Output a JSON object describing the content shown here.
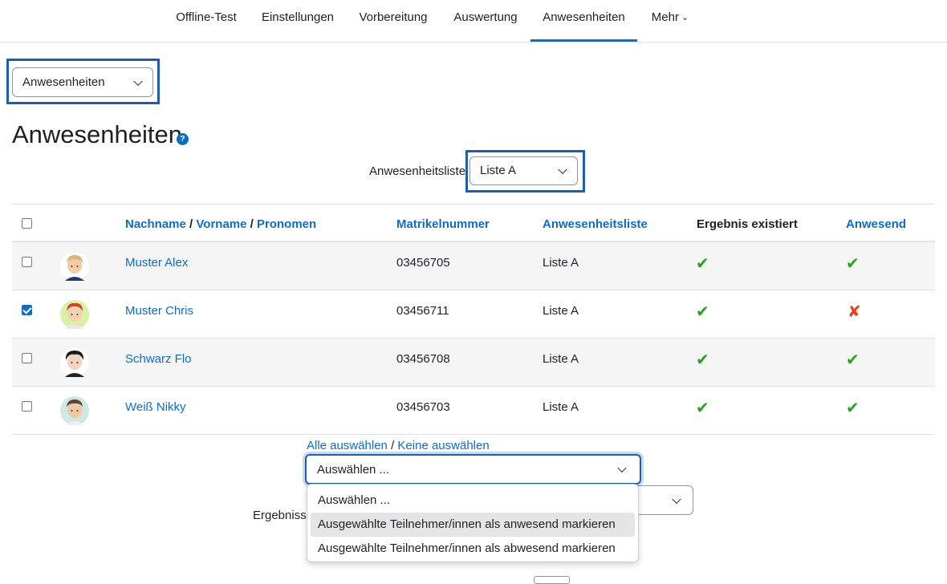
{
  "nav": {
    "items": [
      {
        "label": "Offline-Test"
      },
      {
        "label": "Einstellungen"
      },
      {
        "label": "Vorbereitung"
      },
      {
        "label": "Auswertung"
      },
      {
        "label": "Anwesenheiten",
        "active": true
      },
      {
        "label": "Mehr"
      }
    ]
  },
  "page_select": {
    "value": "Anwesenheiten"
  },
  "page": {
    "title": "Anwesenheiten",
    "help_icon": "question-circle-icon"
  },
  "list_filter": {
    "label": "Anwesenheitsliste:",
    "value": "Liste A"
  },
  "table": {
    "headers": {
      "nachname": "Nachname",
      "sep1": "/",
      "vorname": "Vorname",
      "sep2": "/",
      "pronomen": "Pronomen",
      "matrikel": "Matrikelnummer",
      "liste": "Anwesenheitsliste",
      "ergebnis": "Ergebnis existiert",
      "anwesend": "Anwesend"
    },
    "rows": [
      {
        "name": "Muster Alex",
        "matrikel": "03456705",
        "liste": "Liste A",
        "ergebnis": "✔",
        "anwesend": "✔",
        "selected": false
      },
      {
        "name": "Muster Chris",
        "matrikel": "03456711",
        "liste": "Liste A",
        "ergebnis": "✔",
        "anwesend": "✘",
        "selected": true
      },
      {
        "name": "Schwarz Flo",
        "matrikel": "03456708",
        "liste": "Liste A",
        "ergebnis": "✔",
        "anwesend": "✔",
        "selected": false
      },
      {
        "name": "Weiß Nikky",
        "matrikel": "03456703",
        "liste": "Liste A",
        "ergebnis": "✔",
        "anwesend": "✔",
        "selected": false
      }
    ]
  },
  "selection": {
    "all": "Alle auswählen",
    "sep": "/",
    "none": "Keine auswählen"
  },
  "action_select": {
    "value": "Auswählen ...",
    "options": [
      "Auswählen ...",
      "Ausgewählte Teilnehmer/innen als anwesend markieren",
      "Ausgewählte Teilnehmer/innen als abwesend markieren"
    ]
  },
  "results": {
    "label": "Ergebnisse"
  },
  "colors": {
    "accent": "#0f6cbf",
    "highlight": "#1f5fa6",
    "tick": "#2aa11f",
    "cross": "#e2421b"
  }
}
